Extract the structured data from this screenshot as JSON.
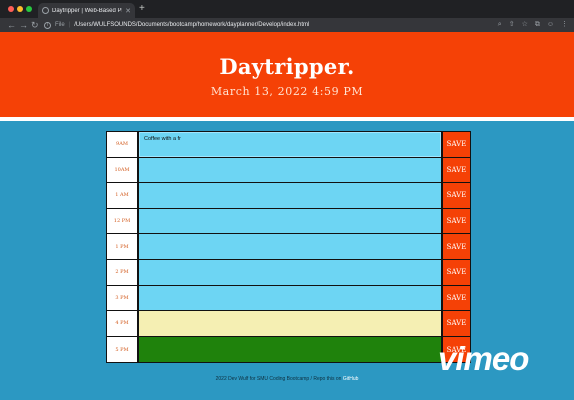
{
  "browser": {
    "tab_title": "Daytripper | Web-Based Planner",
    "tab_close": "✕",
    "new_tab": "+",
    "nav_back": "←",
    "nav_forward": "→",
    "nav_reload": "↻",
    "info_icon": "i",
    "url_scheme": "File",
    "url_separator": "|",
    "url_path": "/Users/WULFSOUNDS/Documents/bootcamp/homework/dayplanner/Develop/index.html",
    "toolbar_icons": [
      "⌕",
      "⇧",
      "☆",
      "⧉",
      "☺",
      "⋮"
    ]
  },
  "header": {
    "title": "Daytripper.",
    "datetime": "March 13, 2022 4:59 PM"
  },
  "rows": [
    {
      "hour": "9AM",
      "task": "Coffee with a fr",
      "state": "present"
    },
    {
      "hour": "10AM",
      "task": "",
      "state": "future"
    },
    {
      "hour": "1 AM",
      "task": "",
      "state": "future"
    },
    {
      "hour": "12 PM",
      "task": "",
      "state": "future"
    },
    {
      "hour": "1 PM",
      "task": "",
      "state": "future"
    },
    {
      "hour": "2 PM",
      "task": "",
      "state": "future"
    },
    {
      "hour": "3 PM",
      "task": "",
      "state": "future"
    },
    {
      "hour": "4 PM",
      "task": "",
      "state": "soon"
    },
    {
      "hour": "5 PM",
      "task": "",
      "state": "later"
    }
  ],
  "save_label": "SAVE",
  "footer": {
    "text": "2022 Dev Wulf for SMU Coding Bootcamp / Repo this on ",
    "link": "GitHub"
  },
  "watermark": "vimeo",
  "colors": {
    "accent": "#f54106",
    "page_background": "#2c98c2",
    "row_present": "#6dd5f3",
    "row_soon": "#f5efb3",
    "row_later": "#1f820c"
  }
}
